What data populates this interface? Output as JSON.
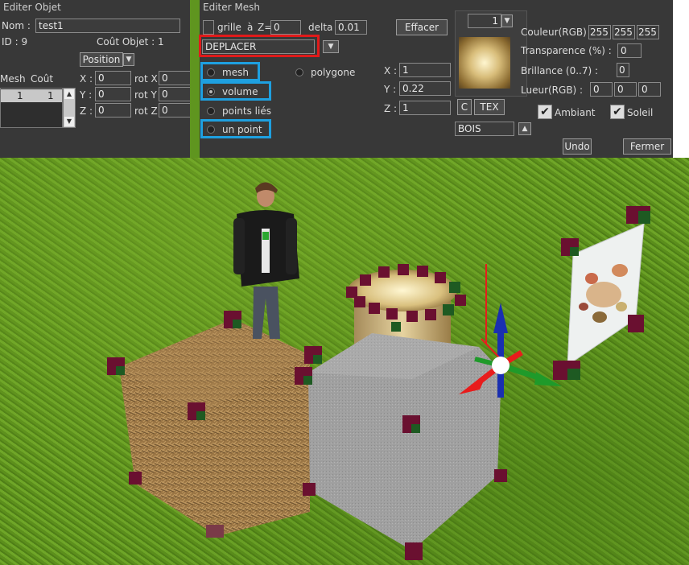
{
  "editer_objet": {
    "title": "Editer Objet",
    "nom_label": "Nom :",
    "nom_value": "test1",
    "id_label": "ID : 9",
    "cout_objet_label": "Coût Objet : 1",
    "mode_value": "Position",
    "mesh_col": "Mesh",
    "cout_col": "Coût",
    "row": {
      "mesh": "1",
      "cout": "1"
    },
    "x_label": "X :",
    "x_value": "0",
    "y_label": "Y :",
    "y_value": "0",
    "z_label": "Z :",
    "z_value": "0",
    "rotx_label": "rot X",
    "rotx_value": "0",
    "roty_label": "rot Y",
    "roty_value": "0",
    "rotz_label": "rot Z",
    "rotz_value": "0"
  },
  "editer_mesh": {
    "title": "Editer Mesh",
    "grille_label": "grille",
    "a_label": "à",
    "z_label": "Z=",
    "z_value": "0",
    "delta_label": "delta",
    "delta_value": "0.01",
    "effacer_label": "Effacer",
    "action_value": "DEPLACER",
    "options": {
      "mesh": "mesh",
      "polygone": "polygone",
      "volume": "volume",
      "points_lies": "points liés",
      "un_point": "un point"
    },
    "x_label": "X :",
    "x_value": "1",
    "y_label": "Y :",
    "y_value": "0.22",
    "z2_label": "Z :",
    "z2_value": "1",
    "index_value": "1",
    "c_label": "C",
    "tex_label": "TEX",
    "material_value": "BOIS",
    "couleur_label": "Couleur(RGB)",
    "couleur_r": "255",
    "couleur_g": "255",
    "couleur_b": "255",
    "transparence_label": "Transparence (%) :",
    "transparence_value": "0",
    "brillance_label": "Brillance (0..7) :",
    "brillance_value": "0",
    "lueur_label": "Lueur(RGB) :",
    "lueur_r": "0",
    "lueur_g": "0",
    "lueur_b": "0",
    "ambiant_label": "Ambiant",
    "soleil_label": "Soleil",
    "undo_label": "Undo",
    "fermer_label": "Fermer"
  },
  "colors": {
    "panel_bg": "#383838",
    "highlight_red": "#e01a1a",
    "highlight_blue": "#1ea0e0",
    "grass": "#5f951f",
    "gizmo_red": "#e81c1c",
    "gizmo_green": "#1f9a2a",
    "gizmo_blue": "#1a2fb0"
  }
}
